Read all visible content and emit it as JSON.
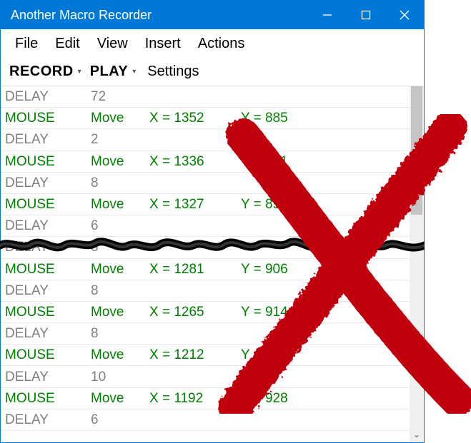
{
  "titlebar": {
    "title": "Another Macro Recorder"
  },
  "menubar": {
    "items": [
      "File",
      "Edit",
      "View",
      "Insert",
      "Actions"
    ]
  },
  "toolbar": {
    "record": "RECORD",
    "play": "PLAY",
    "settings": "Settings"
  },
  "rows": [
    {
      "type": "delay",
      "c1": "DELAY",
      "c2": "72",
      "c3": "",
      "c4": ""
    },
    {
      "type": "mouse",
      "c1": "MOUSE",
      "c2": "Move",
      "c3": "X = 1352",
      "c4": "Y = 885"
    },
    {
      "type": "delay",
      "c1": "DELAY",
      "c2": "2",
      "c3": "",
      "c4": ""
    },
    {
      "type": "mouse",
      "c1": "MOUSE",
      "c2": "Move",
      "c3": "X = 1336",
      "c4": "Y = 891"
    },
    {
      "type": "delay",
      "c1": "DELAY",
      "c2": "8",
      "c3": "",
      "c4": ""
    },
    {
      "type": "mouse",
      "c1": "MOUSE",
      "c2": "Move",
      "c3": "X = 1327",
      "c4": "Y = 895"
    },
    {
      "type": "delay",
      "c1": "DELAY",
      "c2": "6",
      "c3": "",
      "c4": ""
    },
    {
      "type": "delay",
      "c1": "DELAY",
      "c2": "8",
      "c3": "",
      "c4": ""
    },
    {
      "type": "mouse",
      "c1": "MOUSE",
      "c2": "Move",
      "c3": "X = 1281",
      "c4": "Y = 906"
    },
    {
      "type": "delay",
      "c1": "DELAY",
      "c2": "8",
      "c3": "",
      "c4": ""
    },
    {
      "type": "mouse",
      "c1": "MOUSE",
      "c2": "Move",
      "c3": "X = 1265",
      "c4": "Y = 914"
    },
    {
      "type": "delay",
      "c1": "DELAY",
      "c2": "8",
      "c3": "",
      "c4": ""
    },
    {
      "type": "mouse",
      "c1": "MOUSE",
      "c2": "Move",
      "c3": "X = 1212",
      "c4": "Y = 923"
    },
    {
      "type": "delay",
      "c1": "DELAY",
      "c2": "10",
      "c3": "",
      "c4": ""
    },
    {
      "type": "mouse",
      "c1": "MOUSE",
      "c2": "Move",
      "c3": "X = 1192",
      "c4": "Y = 928"
    },
    {
      "type": "delay",
      "c1": "DELAY",
      "c2": "6",
      "c3": "",
      "c4": ""
    }
  ],
  "colors": {
    "titlebar": "#0078d7",
    "mouse_row": "#008000",
    "delay_row": "#808080",
    "cross": "#c00010"
  }
}
